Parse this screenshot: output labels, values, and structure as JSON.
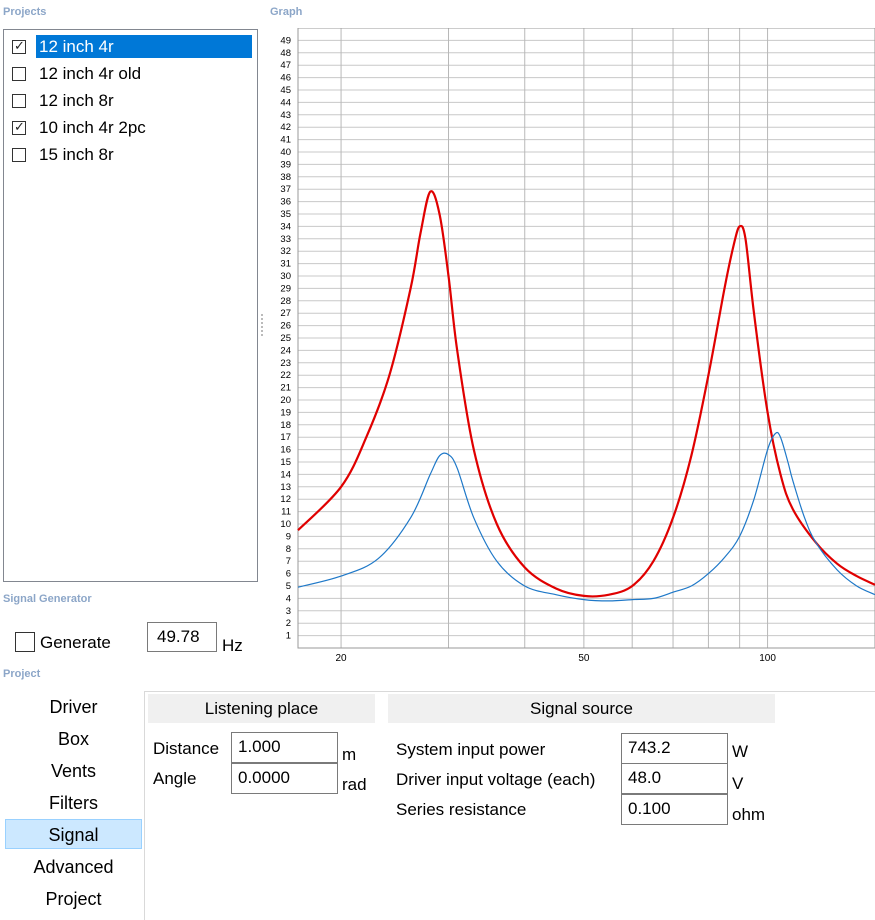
{
  "sections": {
    "projects": "Projects",
    "graph": "Graph",
    "signal_generator": "Signal Generator",
    "project": "Project"
  },
  "projects": [
    {
      "name": "12 inch 4r",
      "checked": true,
      "selected": true
    },
    {
      "name": "12 inch 4r old",
      "checked": false,
      "selected": false
    },
    {
      "name": "12 inch 8r",
      "checked": false,
      "selected": false
    },
    {
      "name": "10 inch 4r 2pc",
      "checked": true,
      "selected": false
    },
    {
      "name": "15 inch 8r",
      "checked": false,
      "selected": false
    }
  ],
  "chart_data": {
    "type": "line",
    "xscale": "log",
    "xlim": [
      17,
      150
    ],
    "ylim": [
      0,
      50
    ],
    "x_ticks": [
      "20",
      "50",
      "100"
    ],
    "y_ticks": [
      "1",
      "2",
      "3",
      "4",
      "5",
      "6",
      "7",
      "8",
      "9",
      "10",
      "11",
      "12",
      "13",
      "14",
      "15",
      "16",
      "17",
      "18",
      "19",
      "20",
      "21",
      "22",
      "23",
      "24",
      "25",
      "26",
      "27",
      "28",
      "29",
      "30",
      "31",
      "32",
      "33",
      "34",
      "35",
      "36",
      "37",
      "38",
      "39",
      "40",
      "41",
      "42",
      "43",
      "44",
      "45",
      "46",
      "47",
      "48",
      "49"
    ],
    "series": [
      {
        "color": "#e00000",
        "x": [
          17,
          20,
          22,
          24,
          26,
          27,
          28,
          29,
          30,
          31,
          33,
          36,
          40,
          45,
          50,
          55,
          60,
          65,
          70,
          75,
          80,
          85,
          88,
          90,
          92,
          95,
          100,
          105,
          110,
          120,
          130,
          140,
          150
        ],
        "values": [
          9.5,
          13,
          17,
          22,
          29,
          33.5,
          36.8,
          35,
          30,
          24,
          16,
          10,
          6.5,
          4.8,
          4.2,
          4.3,
          5,
          7,
          10.5,
          15.5,
          22,
          29,
          32.5,
          34,
          33,
          27,
          19,
          14,
          11.2,
          8.5,
          6.8,
          5.8,
          5.1
        ]
      },
      {
        "color": "#1e78c8",
        "x": [
          17,
          20,
          23,
          26,
          28,
          29,
          30,
          31,
          33,
          36,
          40,
          45,
          50,
          55,
          60,
          65,
          70,
          75,
          80,
          85,
          90,
          95,
          100,
          103,
          105,
          108,
          110,
          115,
          120,
          130,
          140,
          150
        ],
        "values": [
          4.9,
          5.8,
          7.2,
          10.5,
          14,
          15.5,
          15.6,
          14.5,
          10.5,
          7,
          5,
          4.3,
          3.9,
          3.8,
          3.9,
          4,
          4.5,
          5,
          6,
          7.3,
          9,
          12,
          16,
          17.3,
          17,
          15,
          13.5,
          10.5,
          8.5,
          6.3,
          5,
          4.3
        ]
      }
    ]
  },
  "signal_generator": {
    "generate_label": "Generate",
    "generate_checked": false,
    "frequency": "49.78",
    "unit": "Hz"
  },
  "nav": {
    "items": [
      "Driver",
      "Box",
      "Vents",
      "Filters",
      "Signal",
      "Advanced",
      "Project"
    ],
    "active": "Signal"
  },
  "listening_place": {
    "header": "Listening place",
    "distance_label": "Distance",
    "distance_value": "1.000",
    "distance_unit": "m",
    "angle_label": "Angle",
    "angle_value": "0.0000",
    "angle_unit": "rad"
  },
  "signal_source": {
    "header": "Signal source",
    "power_label": "System input power",
    "power_value": "743.2",
    "power_unit": "W",
    "voltage_label": "Driver input voltage (each)",
    "voltage_value": "48.0",
    "voltage_unit": "V",
    "resistance_label": "Series resistance",
    "resistance_value": "0.100",
    "resistance_unit": "ohm"
  }
}
